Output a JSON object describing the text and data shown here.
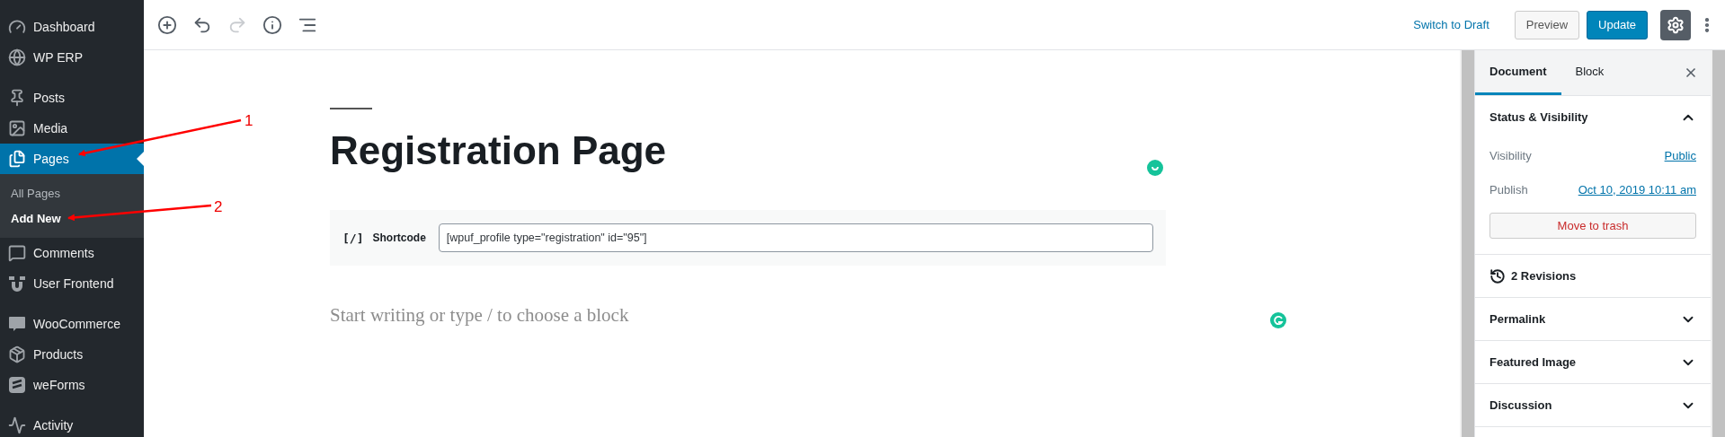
{
  "sidebar": {
    "groups": [
      {
        "items": [
          {
            "label": "Dashboard",
            "selected": false
          },
          {
            "label": "WP ERP",
            "selected": false
          }
        ]
      },
      {
        "items": [
          {
            "label": "Posts",
            "selected": false
          },
          {
            "label": "Media",
            "selected": false
          },
          {
            "label": "Pages",
            "selected": true,
            "children": [
              {
                "label": "All Pages",
                "selected": false
              },
              {
                "label": "Add New",
                "selected": true
              }
            ]
          },
          {
            "label": "Comments",
            "selected": false
          },
          {
            "label": "User Frontend",
            "selected": false
          }
        ]
      },
      {
        "items": [
          {
            "label": "WooCommerce",
            "selected": false
          },
          {
            "label": "Products",
            "selected": false
          },
          {
            "label": "weForms",
            "selected": false
          }
        ]
      },
      {
        "items": [
          {
            "label": "Activity",
            "selected": false
          }
        ]
      }
    ]
  },
  "toolbar": {
    "tools": [
      {
        "kind": "add",
        "disabled": false
      },
      {
        "kind": "undo",
        "disabled": false
      },
      {
        "kind": "redo",
        "disabled": true
      },
      {
        "kind": "info",
        "disabled": false
      },
      {
        "kind": "outline",
        "disabled": false
      }
    ]
  },
  "header_actions": {
    "switch_link": "Switch to Draft",
    "preview_button": "Preview",
    "update_button": "Update",
    "settings_selected": true
  },
  "editor": {
    "title": "Registration Page",
    "shortcode_block": {
      "icon": "[/]",
      "label": "Shortcode",
      "value": "[wpuf_profile type=\"registration\" id=\"95\"]"
    },
    "placeholder": "Start writing or type / to choose a block"
  },
  "panel": {
    "tabs": [
      {
        "label": "Document",
        "selected": true
      },
      {
        "label": "Block",
        "selected": false
      }
    ],
    "sections": [
      {
        "kind": "status",
        "title": "Status & Visibility",
        "expanded": true,
        "rows": [
          {
            "label": "Visibility",
            "value": "Public"
          },
          {
            "label": "Publish",
            "value": "Oct 10, 2019 10:11 am"
          }
        ],
        "button": "Move to trash"
      },
      {
        "kind": "revisions",
        "title": "2 Revisions"
      },
      {
        "kind": "collapsible",
        "title": "Permalink",
        "expanded": false
      },
      {
        "kind": "collapsible",
        "title": "Featured Image",
        "expanded": false
      },
      {
        "kind": "collapsible",
        "title": "Discussion",
        "expanded": false
      }
    ]
  },
  "annotations": [
    {
      "label": "1"
    },
    {
      "label": "2"
    }
  ]
}
